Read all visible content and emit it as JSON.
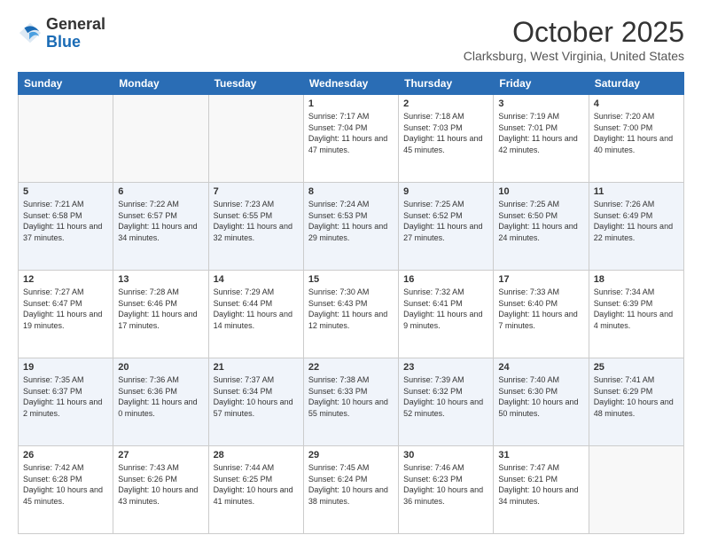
{
  "header": {
    "logo_line1": "General",
    "logo_line2": "Blue",
    "month": "October 2025",
    "location": "Clarksburg, West Virginia, United States"
  },
  "days_of_week": [
    "Sunday",
    "Monday",
    "Tuesday",
    "Wednesday",
    "Thursday",
    "Friday",
    "Saturday"
  ],
  "weeks": [
    [
      {
        "day": "",
        "info": ""
      },
      {
        "day": "",
        "info": ""
      },
      {
        "day": "",
        "info": ""
      },
      {
        "day": "1",
        "info": "Sunrise: 7:17 AM\nSunset: 7:04 PM\nDaylight: 11 hours\nand 47 minutes."
      },
      {
        "day": "2",
        "info": "Sunrise: 7:18 AM\nSunset: 7:03 PM\nDaylight: 11 hours\nand 45 minutes."
      },
      {
        "day": "3",
        "info": "Sunrise: 7:19 AM\nSunset: 7:01 PM\nDaylight: 11 hours\nand 42 minutes."
      },
      {
        "day": "4",
        "info": "Sunrise: 7:20 AM\nSunset: 7:00 PM\nDaylight: 11 hours\nand 40 minutes."
      }
    ],
    [
      {
        "day": "5",
        "info": "Sunrise: 7:21 AM\nSunset: 6:58 PM\nDaylight: 11 hours\nand 37 minutes."
      },
      {
        "day": "6",
        "info": "Sunrise: 7:22 AM\nSunset: 6:57 PM\nDaylight: 11 hours\nand 34 minutes."
      },
      {
        "day": "7",
        "info": "Sunrise: 7:23 AM\nSunset: 6:55 PM\nDaylight: 11 hours\nand 32 minutes."
      },
      {
        "day": "8",
        "info": "Sunrise: 7:24 AM\nSunset: 6:53 PM\nDaylight: 11 hours\nand 29 minutes."
      },
      {
        "day": "9",
        "info": "Sunrise: 7:25 AM\nSunset: 6:52 PM\nDaylight: 11 hours\nand 27 minutes."
      },
      {
        "day": "10",
        "info": "Sunrise: 7:25 AM\nSunset: 6:50 PM\nDaylight: 11 hours\nand 24 minutes."
      },
      {
        "day": "11",
        "info": "Sunrise: 7:26 AM\nSunset: 6:49 PM\nDaylight: 11 hours\nand 22 minutes."
      }
    ],
    [
      {
        "day": "12",
        "info": "Sunrise: 7:27 AM\nSunset: 6:47 PM\nDaylight: 11 hours\nand 19 minutes."
      },
      {
        "day": "13",
        "info": "Sunrise: 7:28 AM\nSunset: 6:46 PM\nDaylight: 11 hours\nand 17 minutes."
      },
      {
        "day": "14",
        "info": "Sunrise: 7:29 AM\nSunset: 6:44 PM\nDaylight: 11 hours\nand 14 minutes."
      },
      {
        "day": "15",
        "info": "Sunrise: 7:30 AM\nSunset: 6:43 PM\nDaylight: 11 hours\nand 12 minutes."
      },
      {
        "day": "16",
        "info": "Sunrise: 7:32 AM\nSunset: 6:41 PM\nDaylight: 11 hours\nand 9 minutes."
      },
      {
        "day": "17",
        "info": "Sunrise: 7:33 AM\nSunset: 6:40 PM\nDaylight: 11 hours\nand 7 minutes."
      },
      {
        "day": "18",
        "info": "Sunrise: 7:34 AM\nSunset: 6:39 PM\nDaylight: 11 hours\nand 4 minutes."
      }
    ],
    [
      {
        "day": "19",
        "info": "Sunrise: 7:35 AM\nSunset: 6:37 PM\nDaylight: 11 hours\nand 2 minutes."
      },
      {
        "day": "20",
        "info": "Sunrise: 7:36 AM\nSunset: 6:36 PM\nDaylight: 11 hours\nand 0 minutes."
      },
      {
        "day": "21",
        "info": "Sunrise: 7:37 AM\nSunset: 6:34 PM\nDaylight: 10 hours\nand 57 minutes."
      },
      {
        "day": "22",
        "info": "Sunrise: 7:38 AM\nSunset: 6:33 PM\nDaylight: 10 hours\nand 55 minutes."
      },
      {
        "day": "23",
        "info": "Sunrise: 7:39 AM\nSunset: 6:32 PM\nDaylight: 10 hours\nand 52 minutes."
      },
      {
        "day": "24",
        "info": "Sunrise: 7:40 AM\nSunset: 6:30 PM\nDaylight: 10 hours\nand 50 minutes."
      },
      {
        "day": "25",
        "info": "Sunrise: 7:41 AM\nSunset: 6:29 PM\nDaylight: 10 hours\nand 48 minutes."
      }
    ],
    [
      {
        "day": "26",
        "info": "Sunrise: 7:42 AM\nSunset: 6:28 PM\nDaylight: 10 hours\nand 45 minutes."
      },
      {
        "day": "27",
        "info": "Sunrise: 7:43 AM\nSunset: 6:26 PM\nDaylight: 10 hours\nand 43 minutes."
      },
      {
        "day": "28",
        "info": "Sunrise: 7:44 AM\nSunset: 6:25 PM\nDaylight: 10 hours\nand 41 minutes."
      },
      {
        "day": "29",
        "info": "Sunrise: 7:45 AM\nSunset: 6:24 PM\nDaylight: 10 hours\nand 38 minutes."
      },
      {
        "day": "30",
        "info": "Sunrise: 7:46 AM\nSunset: 6:23 PM\nDaylight: 10 hours\nand 36 minutes."
      },
      {
        "day": "31",
        "info": "Sunrise: 7:47 AM\nSunset: 6:21 PM\nDaylight: 10 hours\nand 34 minutes."
      },
      {
        "day": "",
        "info": ""
      }
    ]
  ]
}
